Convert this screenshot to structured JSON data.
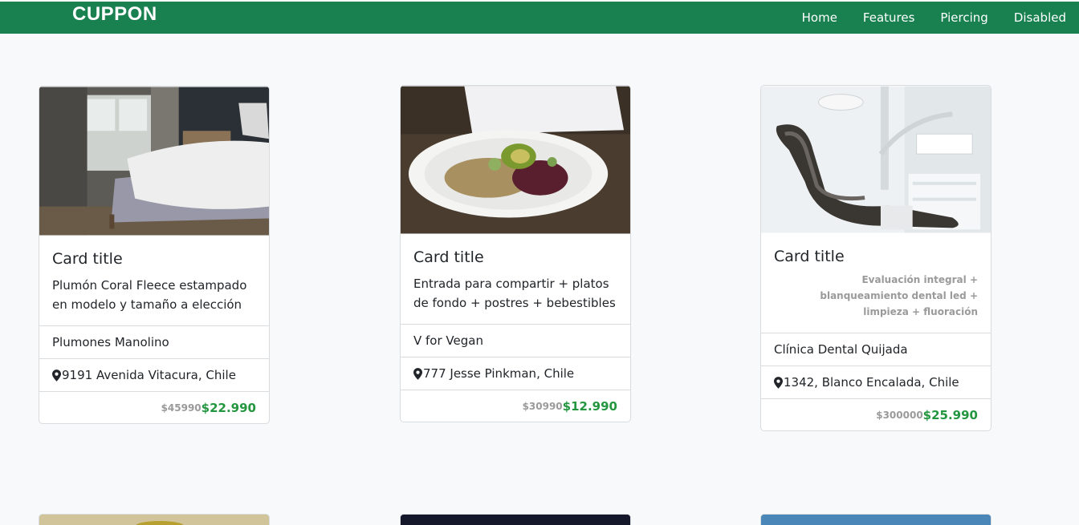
{
  "navbar": {
    "brand": "CUPPON",
    "links": [
      {
        "label": "Home"
      },
      {
        "label": "Features"
      },
      {
        "label": "Piercing"
      },
      {
        "label": "Disabled"
      }
    ]
  },
  "cards": [
    {
      "title": "Card title",
      "description": "Plumón Coral Fleece estampado en modelo y tamaño a elección",
      "merchant": "Plumones Manolino",
      "address": "9191 Avenida Vitacura, Chile",
      "old_price": "$45990",
      "price": "$22.990",
      "image_icon": "bedroom-photo"
    },
    {
      "title": "Card title",
      "description": "Entrada para compartir + platos de fondo + postres + bebestibles",
      "merchant": "V for Vegan",
      "address": "777 Jesse Pinkman, Chile",
      "old_price": "$30990",
      "price": "$12.990",
      "image_icon": "salad-photo"
    },
    {
      "title": "Card title",
      "description": "Evaluación integral + blanqueamiento dental led + limpieza + fluoración",
      "merchant": "Clínica Dental Quijada",
      "address": "1342, Blanco Encalada, Chile",
      "old_price": "$300000",
      "price": "$25.990",
      "image_icon": "dental-chair-photo"
    }
  ],
  "colors": {
    "navbar": "#198050",
    "price": "#23963f",
    "muted": "#9a9a9a"
  }
}
